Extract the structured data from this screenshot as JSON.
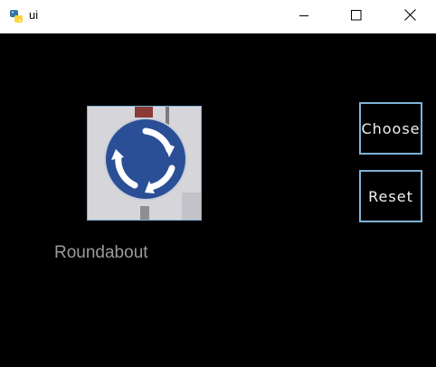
{
  "window": {
    "title": "ui",
    "app_icon": "python-icon",
    "controls": {
      "minimize_icon": "minimize-icon",
      "maximize_icon": "maximize-icon",
      "close_icon": "close-icon"
    }
  },
  "image": {
    "depicts": "roundabout-sign"
  },
  "result": {
    "label": "Roundabout"
  },
  "buttons": {
    "choose_label": "Choose",
    "reset_label": "Reset"
  },
  "colors": {
    "background": "#000000",
    "accent_border": "#7fb2d6",
    "label_text": "#9a9a9a",
    "button_text": "#f0f0f0",
    "sign_blue": "#2b4f96"
  }
}
